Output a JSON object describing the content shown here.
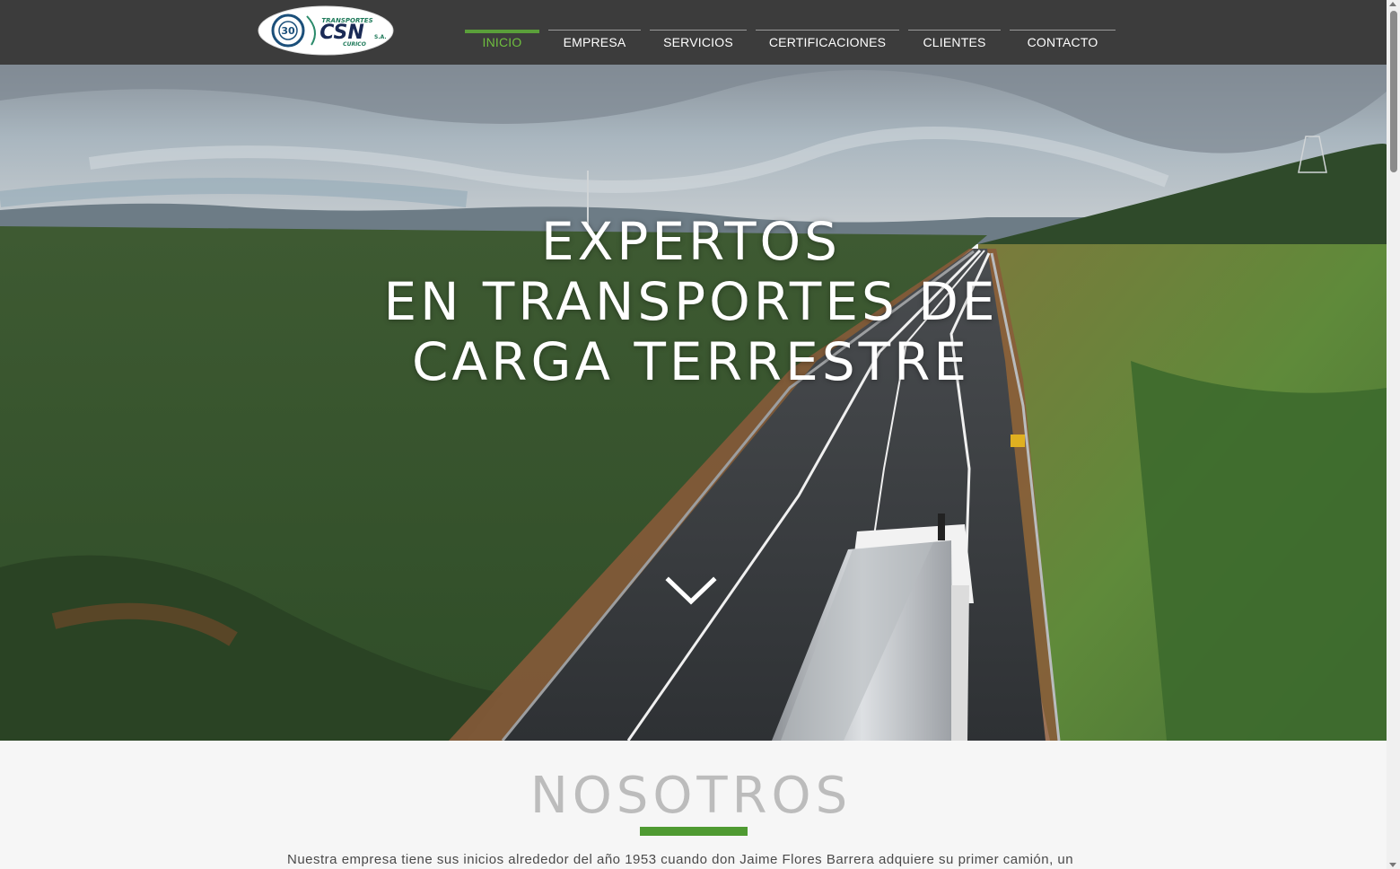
{
  "header": {
    "logo": {
      "top_text": "TRANSPORTES",
      "main_text": "CSN",
      "suffix_text": "S.A.",
      "bottom_text": "CURICO",
      "badge_number": "30"
    },
    "nav": [
      {
        "label": "INICIO",
        "active": true
      },
      {
        "label": "EMPRESA",
        "active": false
      },
      {
        "label": "SERVICIOS",
        "active": false
      },
      {
        "label": "CERTIFICACIONES",
        "active": false
      },
      {
        "label": "CLIENTES",
        "active": false
      },
      {
        "label": "CONTACTO",
        "active": false
      }
    ]
  },
  "hero": {
    "title_lines": [
      "EXPERTOS",
      "EN TRANSPORTES DE",
      "CARGA TERRESTRE"
    ],
    "scroll_icon": "chevron-down-icon"
  },
  "nosotros": {
    "title": "NOSOTROS",
    "text": "Nuestra empresa tiene sus inicios alrededor del año 1953 cuando don Jaime Flores Barrera adquiere su primer camión, un"
  },
  "colors": {
    "header_bg": "#3c3c3c",
    "accent_green": "#5a9f3a",
    "active_nav_text": "#6fbf3f",
    "section_bg": "#f6f6f6",
    "section_title": "#bcbcbc"
  }
}
